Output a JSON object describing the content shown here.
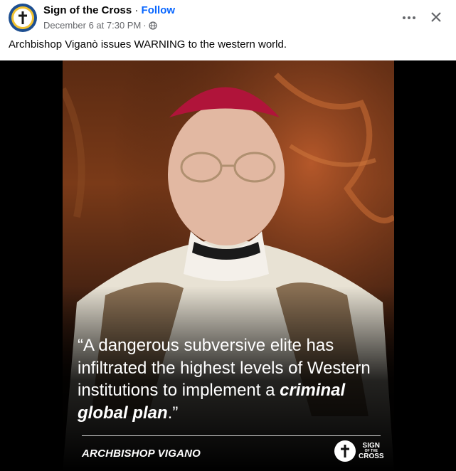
{
  "post": {
    "page_name": "Sign of the Cross",
    "separator": " · ",
    "follow_label": "Follow",
    "timestamp": "December 6 at 7:30 PM",
    "meta_separator": "·",
    "privacy_icon": "globe-icon",
    "body_text": "Archbishop Viganò issues WARNING to the western world.",
    "more_icon": "more-horizontal-icon",
    "close_icon": "close-icon"
  },
  "graphic": {
    "quote_open": "“A dangerous subversive elite has infiltrated the highest levels of Western institutions to implement a ",
    "quote_emphasis": "criminal global plan",
    "quote_close": ".”",
    "attribution": "ARCHBISHOP VIGANO",
    "brand_top": "SIGN",
    "brand_mid": "OF THE",
    "brand_bottom": "CROSS"
  },
  "colors": {
    "accent": "#0866ff",
    "meta_text": "#65676b",
    "media_background": "#000000",
    "avatar_ring": "#1d4f91",
    "avatar_gold": "#f2c230"
  }
}
